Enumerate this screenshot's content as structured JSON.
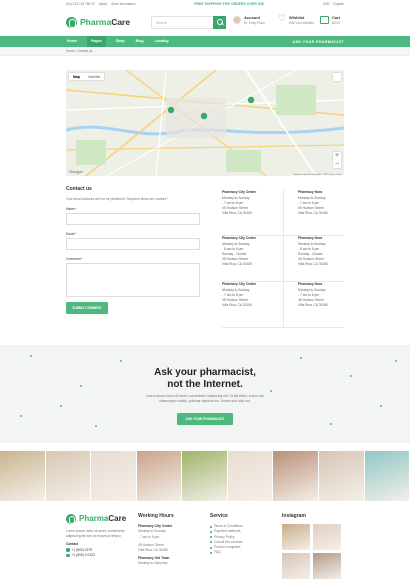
{
  "topbar": {
    "phone": "(00) 123 / 45 789 00",
    "about": "About",
    "store": "Store Information",
    "promo": "FREE SHIPPING FOR ORDERS OVER $35",
    "currency": "USD",
    "language": "English"
  },
  "header": {
    "brand_a": "Pharma",
    "brand_b": "Care",
    "search_placeholder": "Search",
    "account_title": "Account",
    "account_sub": "Hi, Emily Rollo",
    "wishlist_title": "Wishlist",
    "wishlist_sub": "Edit Your Wishlist",
    "cart_title": "Cart",
    "cart_sub": "$0.00"
  },
  "nav": {
    "items": [
      "Home",
      "Pages",
      "Shop",
      "Blog",
      "Landing"
    ],
    "active_index": 1,
    "ask": "ASK YOUR PHARMACIST"
  },
  "breadcrumb": "Home / Contact us",
  "map": {
    "map_type": [
      "Map",
      "Satellite"
    ],
    "zoom_in": "+",
    "zoom_out": "−",
    "google": "Google",
    "attribution": "Keyboard shortcuts  Map data ©2021  Terms of Use"
  },
  "contact": {
    "title": "Contact us",
    "note": "Your email address will not be published. Required fields are marked *",
    "name_label": "Name",
    "email_label": "Email",
    "comment_label": "Comment",
    "submit": "SUBMIT COMMENT"
  },
  "stores": [
    {
      "name": "Pharmacy City Center",
      "l1": "Monday to Sunday",
      "l2": "- 7 am to 8 pm",
      "l3": "45 Hudson Street",
      "l4": "Villa Rica, CA 30180"
    },
    {
      "name": "Pharmacy Nora",
      "l1": "Monday to Sunday",
      "l2": "- 7 am to 8 pm",
      "l3": "45 Hudson Street",
      "l4": "Villa Rica, CA 30180"
    },
    {
      "name": "Pharmacy City Center",
      "l1": "Monday to Sunday",
      "l2": "- 8 am to 6 pm",
      "l3": "Sunday - Closed",
      "l4": "45 Hudson Street\nVilla Rica, CA 30180"
    },
    {
      "name": "Pharmacy Nora",
      "l1": "Monday to Sunday",
      "l2": "- 8 am to 6 pm",
      "l3": "Sunday - Closed",
      "l4": "45 Hudson Street\nVilla Rica, CA 30180"
    },
    {
      "name": "Pharmacy City Center",
      "l1": "Monday to Sunday",
      "l2": "- 7 am to 8 pm",
      "l3": "45 Hudson Street",
      "l4": "Villa Rica, CA 30180"
    },
    {
      "name": "Pharmacy Nora",
      "l1": "Monday to Sunday",
      "l2": "- 7 am to 8 pm",
      "l3": "45 Hudson Street",
      "l4": "Villa Rica, CA 30180"
    }
  ],
  "ask": {
    "title_line1": "Ask your pharmacist,",
    "title_line2": "not the Internet.",
    "text_line1": "Lorem ipsum dolor sit amet, consectetur adipiscing elit. Ut elit tellus, luctus nec",
    "text_line2": "ullamcorper mattis, pulvinar dapibus leo. Donec sed odio dui.",
    "button": "ASK YOUR PHARMACIST"
  },
  "gallery_colors": [
    "#c9b58f",
    "#d8c7b3",
    "#e7dcd2",
    "#caa38a",
    "#9fb46a",
    "#e8ddd1",
    "#b89078",
    "#d7c5b4",
    "#8fc7c4"
  ],
  "footer": {
    "brand_a": "Pharma",
    "brand_b": "Care",
    "about": "Lorem ipsum dolor sit amet, consectetur adipiscing elit sed do eiusmod tempor",
    "contact_label": "Contact",
    "phone1": "+1 (800) 0279",
    "phone2": "+1 (800) 4 0123",
    "hours_title": "Working Hours",
    "hours_store1": "Pharmacy City Center",
    "hours_l1": "Monday to Sunday",
    "hours_l2": "- 7 am to 8 pm",
    "hours_l3": "45 Hudson Street",
    "hours_l4": "Villa Rica, CA 30180",
    "hours_store2": "Pharmacy Old Town",
    "hours_l5": "Monday to Saturday",
    "service_title": "Service",
    "services": [
      "Terms & Conditions",
      "Payment methods",
      "Privacy Policy",
      "Cancel the contract",
      "Product complaint",
      "FAQ"
    ],
    "insta_title": "Instagram",
    "insta_colors": [
      "#c9ad8a",
      "#e0cfc3",
      "#d8c3b6",
      "#b39987"
    ]
  },
  "colors": {
    "accent": "#3aa76d",
    "nav": "#4eb97e"
  }
}
